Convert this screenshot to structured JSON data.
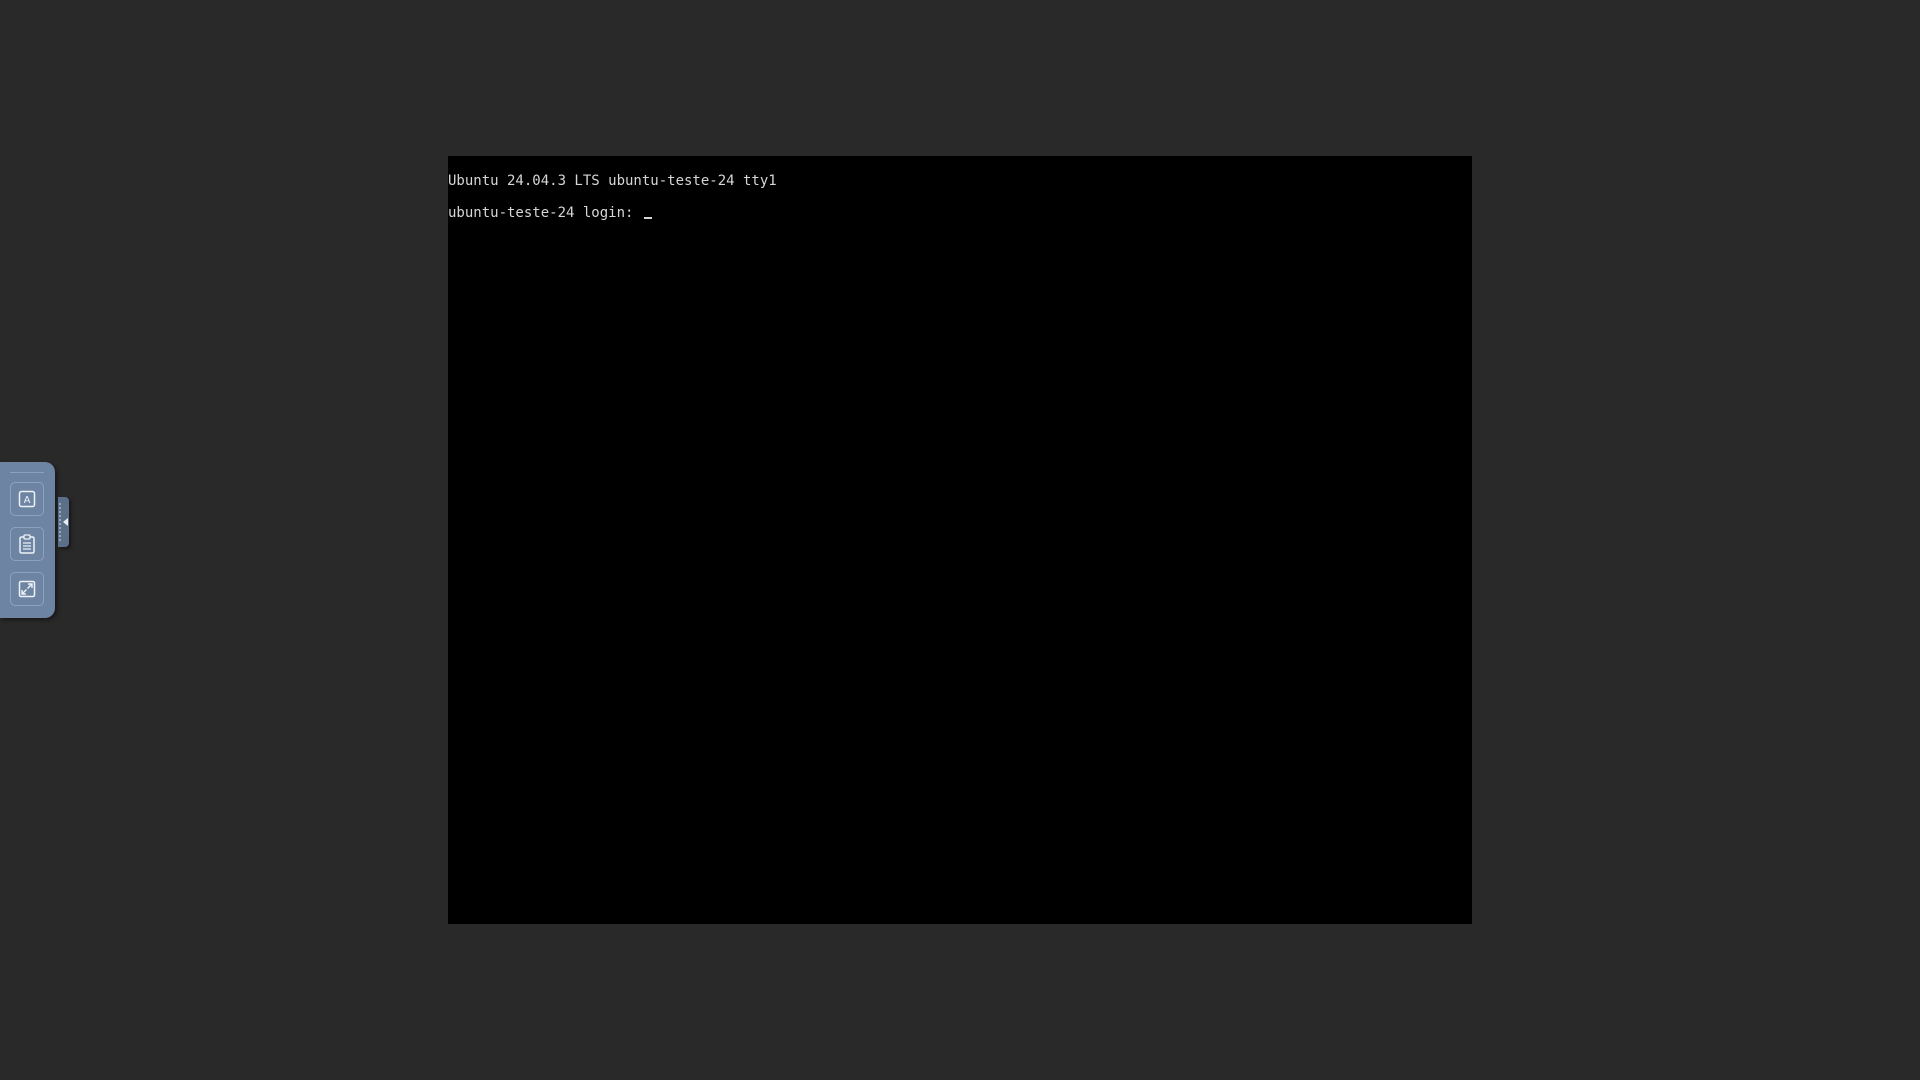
{
  "console": {
    "lines": [
      "Ubuntu 24.04.3 LTS ubuntu-teste-24 tty1",
      "ubuntu-teste-24 login: "
    ],
    "cursor": "_"
  },
  "control_bar": {
    "buttons": [
      {
        "icon": "keyboard-icon",
        "glyph": "A"
      },
      {
        "icon": "clipboard-icon"
      },
      {
        "icon": "fullscreen-icon"
      }
    ],
    "handle_icon": "collapse-arrow-icon"
  },
  "colors": {
    "page_background": "#292929",
    "console_background": "#000000",
    "console_text": "#d6d6d6",
    "control_bar": "#6e84a3"
  }
}
